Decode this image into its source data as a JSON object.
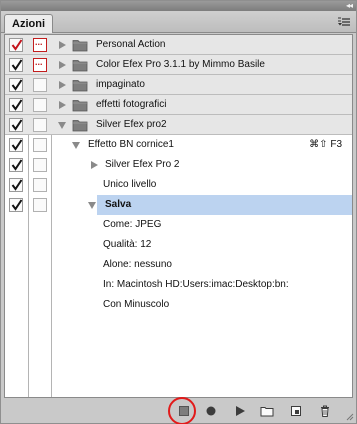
{
  "panel": {
    "tab_label": "Azioni",
    "collapse_glyph": "◂◂"
  },
  "rows": [
    {
      "label": "Personal Action",
      "type": "set",
      "checked": true,
      "check_color": "red",
      "dialog": "red",
      "expanded": false
    },
    {
      "label": "Color Efex Pro 3.1.1 by Mimmo Basile",
      "type": "set",
      "checked": true,
      "check_color": "black",
      "dialog": "red",
      "expanded": false
    },
    {
      "label": "impaginato",
      "type": "set",
      "checked": true,
      "check_color": "black",
      "dialog": "empty",
      "expanded": false
    },
    {
      "label": "effetti fotografici",
      "type": "set",
      "checked": true,
      "check_color": "black",
      "dialog": "empty",
      "expanded": false
    },
    {
      "label": "Silver Efex pro2",
      "type": "set",
      "checked": true,
      "check_color": "black",
      "dialog": "empty",
      "expanded": true
    },
    {
      "label": "Effetto BN cornice1",
      "type": "action",
      "checked": true,
      "check_color": "black",
      "dialog": "empty",
      "expanded": true,
      "shortcut": "⌘⇧ F3"
    },
    {
      "label": "Silver Efex Pro 2",
      "type": "command",
      "checked": true,
      "check_color": "black",
      "dialog": "empty",
      "expanded": false
    },
    {
      "label": "Unico livello",
      "type": "command-leaf",
      "checked": true,
      "check_color": "black",
      "dialog": "empty"
    },
    {
      "label": "Salva",
      "type": "command-open",
      "checked": true,
      "check_color": "black",
      "dialog": "empty",
      "expanded": true,
      "selected": true
    }
  ],
  "salva_details": [
    "Come: JPEG",
    "Qualità: 12",
    "Alone: nessuno",
    "In: Macintosh HD:Users:imac:Desktop:bn:",
    "Con Minuscolo"
  ],
  "toolbar": {
    "icons": [
      "stop-icon",
      "record-icon",
      "play-icon",
      "new-set-icon",
      "new-action-icon",
      "delete-icon"
    ]
  },
  "colors": {
    "selection": "#bcd3f0",
    "highlight_circle": "#e21a1a",
    "red_check": "#c4141c"
  }
}
